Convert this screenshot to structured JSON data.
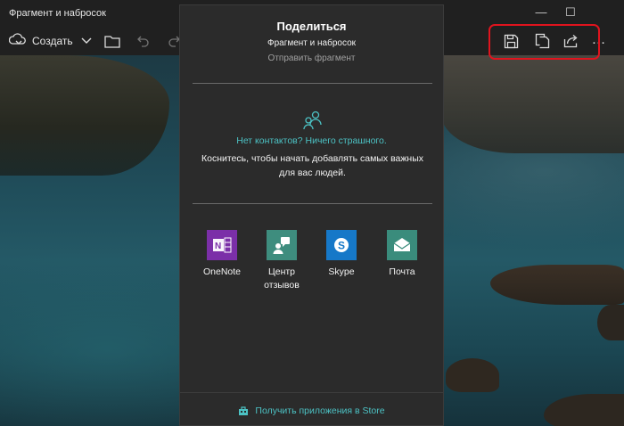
{
  "window": {
    "title": "Фрагмент и набросок",
    "minimize": "—",
    "maximize": "☐"
  },
  "toolbar": {
    "create_label": "Создать",
    "icons": [
      "create-snip-icon",
      "chevron-down-icon",
      "folder-icon",
      "undo-icon",
      "redo-icon",
      "save-icon",
      "copy-icon",
      "share-icon",
      "more-icon"
    ],
    "more_label": "…"
  },
  "share": {
    "title": "Поделиться",
    "subtitle": "Фрагмент и набросок",
    "hint": "Отправить фрагмент",
    "no_contacts": "Нет контактов? Ничего страшного.",
    "contacts_desc": "Коснитесь, чтобы начать добавлять самых важных для вас людей.",
    "apps": [
      {
        "label": "OneNote",
        "icon": "onenote-icon",
        "color": "#7b2fa8"
      },
      {
        "label": "Центр отзывов",
        "icon": "feedback-hub-icon",
        "color": "#3e8d7e"
      },
      {
        "label": "Skype",
        "icon": "skype-icon",
        "color": "#1678c8"
      },
      {
        "label": "Почта",
        "icon": "mail-icon",
        "color": "#3a8c7c"
      }
    ],
    "store_link": "Получить приложения в Store"
  },
  "colors": {
    "accent": "#4cc2c4",
    "highlight": "#e0141e",
    "panel": "#2b2b2b",
    "titlebar": "#202020"
  }
}
